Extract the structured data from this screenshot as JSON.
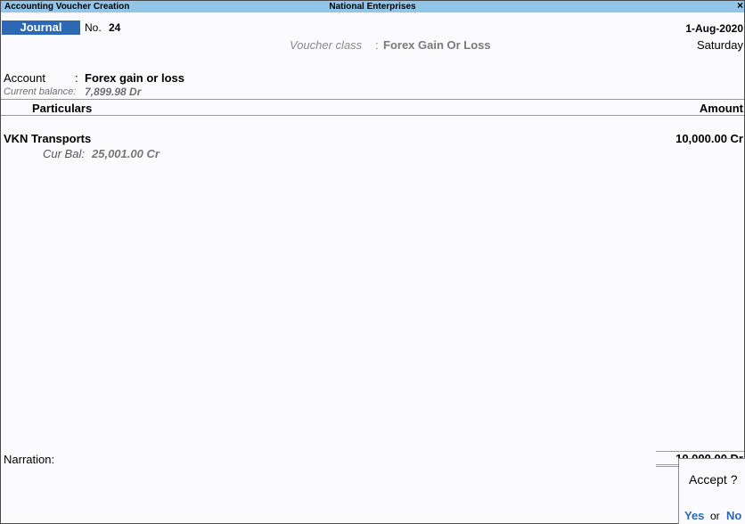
{
  "window": {
    "title": "Accounting Voucher Creation",
    "company": "National Enterprises",
    "close_glyph": "×",
    "close_icon": "close-icon"
  },
  "voucher": {
    "type": "Journal",
    "no_label": "No.",
    "no_value": "24",
    "date": "1-Aug-2020",
    "day": "Saturday",
    "class_label": "Voucher class",
    "class_colon": ":",
    "class_value": "Forex Gain Or Loss"
  },
  "account": {
    "label": "Account",
    "colon": ":",
    "value": "Forex gain or loss",
    "balance_label": "Current balance:",
    "balance_value": "7,899.98 Dr"
  },
  "table": {
    "col_particulars": "Particulars",
    "col_amount": "Amount",
    "rows": [
      {
        "name": "VKN Transports",
        "amount": "10,000.00 Cr",
        "cur_bal_label": "Cur Bal:",
        "cur_bal_value": "25,001.00 Cr"
      }
    ]
  },
  "footer": {
    "narration_label": "Narration:",
    "total": "10,000.00 Dr"
  },
  "dialog": {
    "question": "Accept ?",
    "yes": "Yes",
    "or": "or",
    "no": "No"
  },
  "colors": {
    "titlebar": "#94c5e7",
    "accent": "#2c68b3",
    "background": "#fbfbfd"
  }
}
